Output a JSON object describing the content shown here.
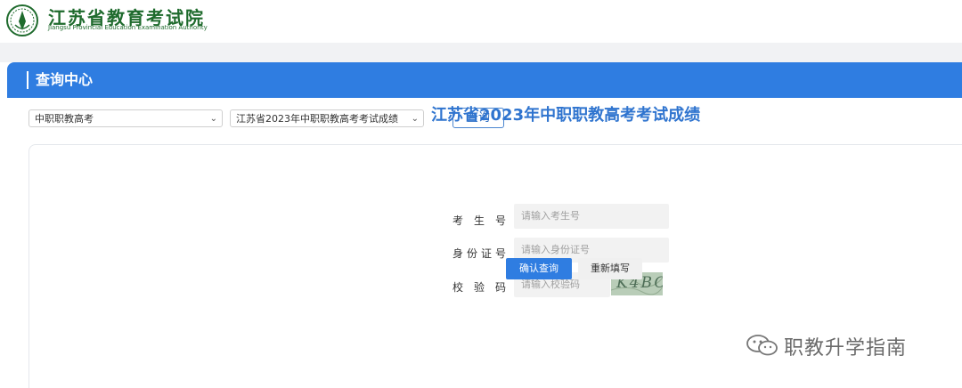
{
  "header": {
    "logo_cn": "江苏省教育考试院",
    "logo_en": "Jiangsu Provincial Education Examination Authority"
  },
  "panel": {
    "title": "查询中心"
  },
  "filters": {
    "category_select": "中职职教高考",
    "exam_select": "江苏省2023年中职职教高考考试成绩",
    "query_button": "查询"
  },
  "form": {
    "title": "江苏省2023年中职职教高考考试成绩",
    "fields": [
      {
        "label": "考 生 号",
        "placeholder": "请输入考生号"
      },
      {
        "label": "身份证号",
        "placeholder": "请输入身份证号"
      },
      {
        "label": "校 验 码",
        "placeholder": "请输入校验码"
      }
    ],
    "captcha_text": "K4BC",
    "confirm_button": "确认查询",
    "reset_button": "重新填写"
  },
  "watermark": {
    "text": "职教升学指南"
  },
  "colors": {
    "accent": "#2f7de1",
    "logo_green": "#1f6b2d"
  }
}
